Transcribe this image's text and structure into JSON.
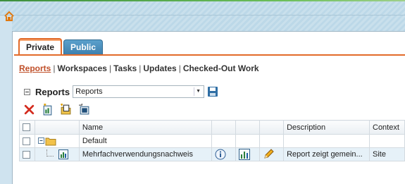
{
  "tabs": [
    {
      "label": "Private",
      "active": true
    },
    {
      "label": "Public",
      "active": false
    }
  ],
  "subnav": [
    {
      "label": "Reports",
      "active": true
    },
    {
      "label": "Workspaces"
    },
    {
      "label": "Tasks"
    },
    {
      "label": "Updates"
    },
    {
      "label": "Checked-Out Work"
    }
  ],
  "reports_section": {
    "label": "Reports",
    "select_value": "Reports"
  },
  "toolbar": {
    "icons": [
      "delete-icon",
      "new-report-icon",
      "new-folder-icon",
      "move-icon"
    ]
  },
  "grid": {
    "columns": [
      "",
      "",
      "Name",
      "",
      "",
      "",
      "Description",
      "Context"
    ],
    "rows": [
      {
        "type": "folder",
        "name": "Default",
        "description": "",
        "context": ""
      },
      {
        "type": "report",
        "name": "Mehrfachverwendungsnachweis",
        "description": "Report zeigt gemein...",
        "context": "Site"
      }
    ]
  },
  "colors": {
    "accent_orange": "#e26b2a",
    "tab_blue": "#3d7fad",
    "link_active": "#c0502a"
  }
}
